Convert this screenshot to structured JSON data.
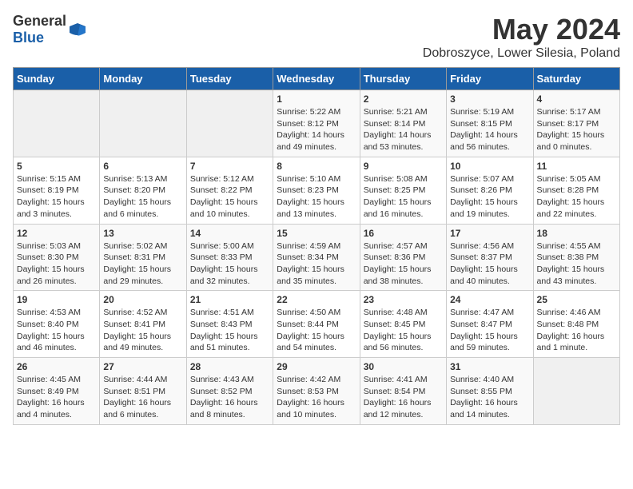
{
  "header": {
    "logo_general": "General",
    "logo_blue": "Blue",
    "month_year": "May 2024",
    "location": "Dobroszyce, Lower Silesia, Poland"
  },
  "days_of_week": [
    "Sunday",
    "Monday",
    "Tuesday",
    "Wednesday",
    "Thursday",
    "Friday",
    "Saturday"
  ],
  "weeks": [
    [
      {
        "day": "",
        "content": ""
      },
      {
        "day": "",
        "content": ""
      },
      {
        "day": "",
        "content": ""
      },
      {
        "day": "1",
        "content": "Sunrise: 5:22 AM\nSunset: 8:12 PM\nDaylight: 14 hours\nand 49 minutes."
      },
      {
        "day": "2",
        "content": "Sunrise: 5:21 AM\nSunset: 8:14 PM\nDaylight: 14 hours\nand 53 minutes."
      },
      {
        "day": "3",
        "content": "Sunrise: 5:19 AM\nSunset: 8:15 PM\nDaylight: 14 hours\nand 56 minutes."
      },
      {
        "day": "4",
        "content": "Sunrise: 5:17 AM\nSunset: 8:17 PM\nDaylight: 15 hours\nand 0 minutes."
      }
    ],
    [
      {
        "day": "5",
        "content": "Sunrise: 5:15 AM\nSunset: 8:19 PM\nDaylight: 15 hours\nand 3 minutes."
      },
      {
        "day": "6",
        "content": "Sunrise: 5:13 AM\nSunset: 8:20 PM\nDaylight: 15 hours\nand 6 minutes."
      },
      {
        "day": "7",
        "content": "Sunrise: 5:12 AM\nSunset: 8:22 PM\nDaylight: 15 hours\nand 10 minutes."
      },
      {
        "day": "8",
        "content": "Sunrise: 5:10 AM\nSunset: 8:23 PM\nDaylight: 15 hours\nand 13 minutes."
      },
      {
        "day": "9",
        "content": "Sunrise: 5:08 AM\nSunset: 8:25 PM\nDaylight: 15 hours\nand 16 minutes."
      },
      {
        "day": "10",
        "content": "Sunrise: 5:07 AM\nSunset: 8:26 PM\nDaylight: 15 hours\nand 19 minutes."
      },
      {
        "day": "11",
        "content": "Sunrise: 5:05 AM\nSunset: 8:28 PM\nDaylight: 15 hours\nand 22 minutes."
      }
    ],
    [
      {
        "day": "12",
        "content": "Sunrise: 5:03 AM\nSunset: 8:30 PM\nDaylight: 15 hours\nand 26 minutes."
      },
      {
        "day": "13",
        "content": "Sunrise: 5:02 AM\nSunset: 8:31 PM\nDaylight: 15 hours\nand 29 minutes."
      },
      {
        "day": "14",
        "content": "Sunrise: 5:00 AM\nSunset: 8:33 PM\nDaylight: 15 hours\nand 32 minutes."
      },
      {
        "day": "15",
        "content": "Sunrise: 4:59 AM\nSunset: 8:34 PM\nDaylight: 15 hours\nand 35 minutes."
      },
      {
        "day": "16",
        "content": "Sunrise: 4:57 AM\nSunset: 8:36 PM\nDaylight: 15 hours\nand 38 minutes."
      },
      {
        "day": "17",
        "content": "Sunrise: 4:56 AM\nSunset: 8:37 PM\nDaylight: 15 hours\nand 40 minutes."
      },
      {
        "day": "18",
        "content": "Sunrise: 4:55 AM\nSunset: 8:38 PM\nDaylight: 15 hours\nand 43 minutes."
      }
    ],
    [
      {
        "day": "19",
        "content": "Sunrise: 4:53 AM\nSunset: 8:40 PM\nDaylight: 15 hours\nand 46 minutes."
      },
      {
        "day": "20",
        "content": "Sunrise: 4:52 AM\nSunset: 8:41 PM\nDaylight: 15 hours\nand 49 minutes."
      },
      {
        "day": "21",
        "content": "Sunrise: 4:51 AM\nSunset: 8:43 PM\nDaylight: 15 hours\nand 51 minutes."
      },
      {
        "day": "22",
        "content": "Sunrise: 4:50 AM\nSunset: 8:44 PM\nDaylight: 15 hours\nand 54 minutes."
      },
      {
        "day": "23",
        "content": "Sunrise: 4:48 AM\nSunset: 8:45 PM\nDaylight: 15 hours\nand 56 minutes."
      },
      {
        "day": "24",
        "content": "Sunrise: 4:47 AM\nSunset: 8:47 PM\nDaylight: 15 hours\nand 59 minutes."
      },
      {
        "day": "25",
        "content": "Sunrise: 4:46 AM\nSunset: 8:48 PM\nDaylight: 16 hours\nand 1 minute."
      }
    ],
    [
      {
        "day": "26",
        "content": "Sunrise: 4:45 AM\nSunset: 8:49 PM\nDaylight: 16 hours\nand 4 minutes."
      },
      {
        "day": "27",
        "content": "Sunrise: 4:44 AM\nSunset: 8:51 PM\nDaylight: 16 hours\nand 6 minutes."
      },
      {
        "day": "28",
        "content": "Sunrise: 4:43 AM\nSunset: 8:52 PM\nDaylight: 16 hours\nand 8 minutes."
      },
      {
        "day": "29",
        "content": "Sunrise: 4:42 AM\nSunset: 8:53 PM\nDaylight: 16 hours\nand 10 minutes."
      },
      {
        "day": "30",
        "content": "Sunrise: 4:41 AM\nSunset: 8:54 PM\nDaylight: 16 hours\nand 12 minutes."
      },
      {
        "day": "31",
        "content": "Sunrise: 4:40 AM\nSunset: 8:55 PM\nDaylight: 16 hours\nand 14 minutes."
      },
      {
        "day": "",
        "content": ""
      }
    ]
  ]
}
